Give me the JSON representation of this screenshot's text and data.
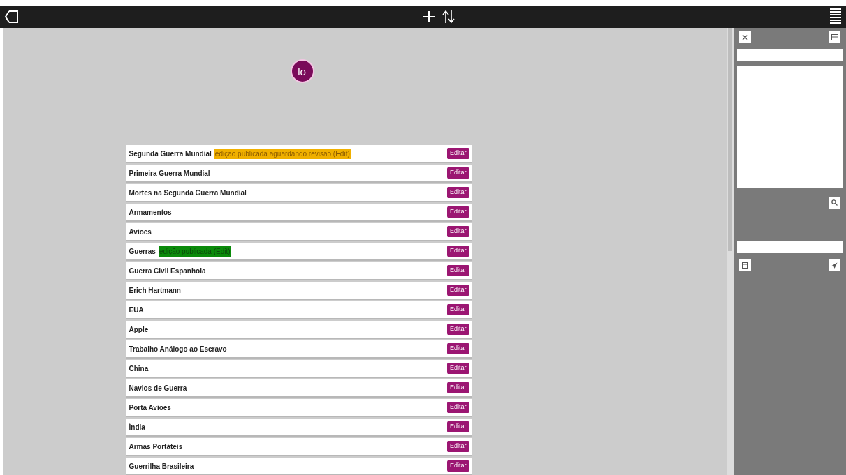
{
  "logo": "lσ",
  "rows": [
    {
      "title": "Segunda Guerra Mundial",
      "status": {
        "kind": "pending",
        "label": "edição publicada aguardando revisão (Edit)"
      },
      "action": "Editar"
    },
    {
      "title": "Primeira Guerra Mundial",
      "action": "Editar"
    },
    {
      "title": "Mortes na Segunda Guerra Mundial",
      "action": "Editar"
    },
    {
      "title": "Armamentos",
      "action": "Editar"
    },
    {
      "title": "Aviões",
      "action": "Editar"
    },
    {
      "title": "Guerras",
      "status": {
        "kind": "published",
        "label": "edição publicada (Edit)"
      },
      "action": "Editar"
    },
    {
      "title": "Guerra Civil Espanhola",
      "action": "Editar"
    },
    {
      "title": "Erich Hartmann",
      "action": "Editar"
    },
    {
      "title": "EUA",
      "action": "Editar"
    },
    {
      "title": "Apple",
      "action": "Editar"
    },
    {
      "title": "Trabalho Análogo ao Escravo",
      "action": "Editar"
    },
    {
      "title": "China",
      "action": "Editar"
    },
    {
      "title": "Navios de Guerra",
      "action": "Editar"
    },
    {
      "title": "Porta Aviões",
      "action": "Editar"
    },
    {
      "title": "Índia",
      "action": "Editar"
    },
    {
      "title": "Armas Portáteis",
      "action": "Editar"
    },
    {
      "title": "Guerrilha Brasileira",
      "action": "Editar"
    }
  ]
}
